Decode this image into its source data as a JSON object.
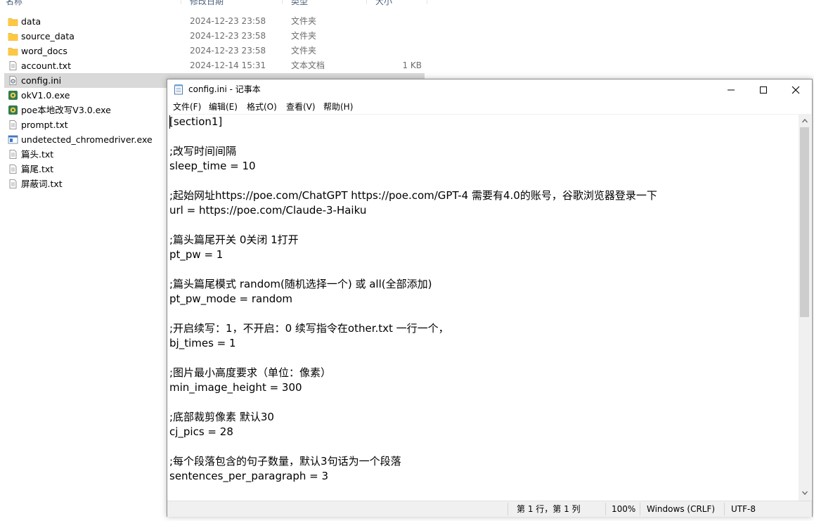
{
  "explorer": {
    "columns": [
      "名称",
      "修改日期",
      "类型",
      "大小"
    ],
    "rows": [
      {
        "name": "data",
        "date": "2024-12-23 23:58",
        "type": "文件夹",
        "size": "",
        "icon": "folder-icon"
      },
      {
        "name": "source_data",
        "date": "2024-12-23 23:58",
        "type": "文件夹",
        "size": "",
        "icon": "folder-icon"
      },
      {
        "name": "word_docs",
        "date": "2024-12-23 23:58",
        "type": "文件夹",
        "size": "",
        "icon": "folder-icon"
      },
      {
        "name": "account.txt",
        "date": "2024-12-14 15:31",
        "type": "文本文档",
        "size": "1 KB",
        "icon": "text-file-icon"
      },
      {
        "name": "config.ini",
        "date": "",
        "type": "",
        "size": "",
        "icon": "settings-file-icon"
      },
      {
        "name": "okV1.0.exe",
        "date": "",
        "type": "",
        "size": "",
        "icon": "app-icon"
      },
      {
        "name": "poe本地改写V3.0.exe",
        "date": "",
        "type": "",
        "size": "",
        "icon": "app-icon"
      },
      {
        "name": "prompt.txt",
        "date": "",
        "type": "",
        "size": "",
        "icon": "text-file-icon"
      },
      {
        "name": "undetected_chromedriver.exe",
        "date": "",
        "type": "",
        "size": "",
        "icon": "exe-icon"
      },
      {
        "name": "篇头.txt",
        "date": "",
        "type": "",
        "size": "",
        "icon": "text-file-icon"
      },
      {
        "name": "篇尾.txt",
        "date": "",
        "type": "",
        "size": "",
        "icon": "text-file-icon"
      },
      {
        "name": "屏蔽词.txt",
        "date": "",
        "type": "",
        "size": "",
        "icon": "text-file-icon"
      }
    ]
  },
  "notepad": {
    "title": "config.ini - 记事本",
    "menu": [
      "文件(F)",
      "编辑(E)",
      "格式(O)",
      "查看(V)",
      "帮助(H)"
    ],
    "lines": [
      "[section1]",
      "",
      ";改写时间间隔",
      "sleep_time = 10",
      "",
      ";起始网址https://poe.com/ChatGPT https://poe.com/GPT-4 需要有4.0的账号，谷歌浏览器登录一下",
      "url = https://poe.com/Claude-3-Haiku",
      "",
      ";篇头篇尾开关 0关闭 1打开",
      "pt_pw = 1",
      "",
      ";篇头篇尾模式 random(随机选择一个) 或 all(全部添加)",
      "pt_pw_mode = random",
      "",
      ";开启续写：1，不开启：0 续写指令在other.txt 一行一个，",
      "bj_times = 1",
      "",
      ";图片最小高度要求（单位：像素）",
      "min_image_height = 300",
      "",
      ";底部裁剪像素 默认30",
      "cj_pics = 28",
      "",
      ";每个段落包含的句子数量，默认3句话为一个段落",
      "sentences_per_paragraph = 3"
    ],
    "status": {
      "position": "第 1 行，第 1 列",
      "zoom": "100%",
      "line_ending": "Windows (CRLF)",
      "encoding": "UTF-8"
    }
  }
}
